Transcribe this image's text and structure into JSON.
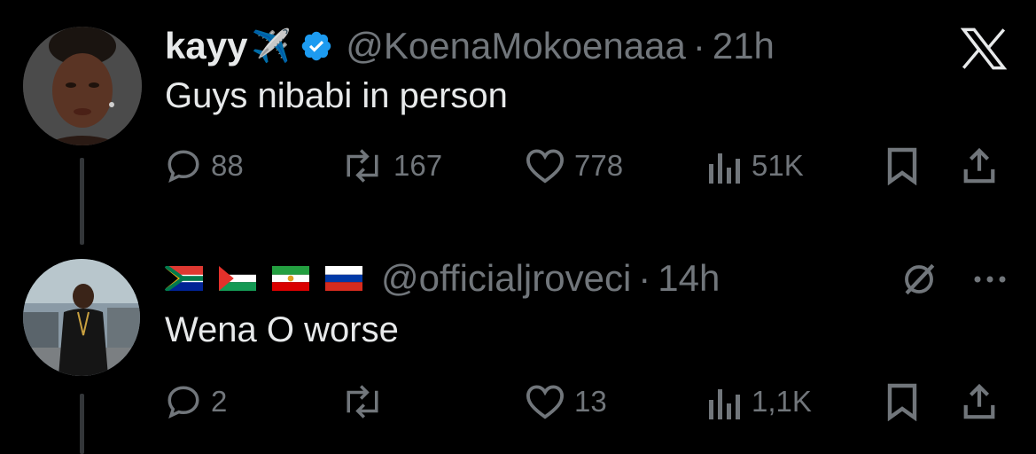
{
  "tweets": [
    {
      "display_name": "kayy",
      "name_emoji": "✈️",
      "verified": true,
      "handle": "@KoenaMokoenaaa",
      "separator": "·",
      "time": "21h",
      "text": "Guys nibabi in person",
      "replies": "88",
      "reposts": "167",
      "likes": "778",
      "views": "51K",
      "top_right_icon": "x-logo-icon"
    },
    {
      "display_name_flags": [
        "south-africa-flag-icon",
        "palestine-flag-icon",
        "iran-lion-sun-flag-icon",
        "russia-flag-icon"
      ],
      "handle": "@officialjroveci",
      "separator": "·",
      "time": "14h",
      "text": "Wena O worse",
      "replies": "2",
      "reposts": "",
      "likes": "13",
      "views": "1,1K",
      "top_right_icons": [
        "grok-icon",
        "more-icon"
      ]
    }
  ],
  "colors": {
    "background": "#000000",
    "text_primary": "#e7e9ea",
    "text_secondary": "#71767b",
    "verified_blue": "#1d9bf0",
    "thread_line": "#333639"
  }
}
